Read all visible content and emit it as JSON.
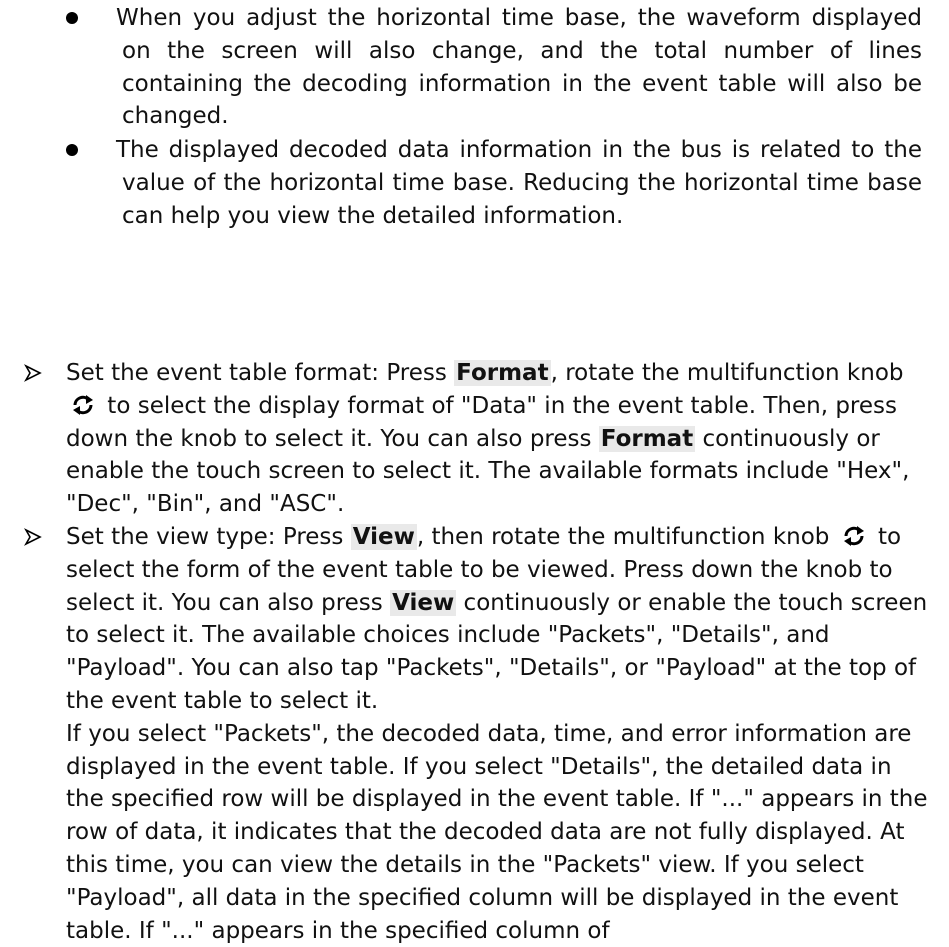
{
  "notes": [
    "When you adjust the horizontal time base, the waveform displayed on the screen will also change, and the total number of lines containing the decoding information in the event table will also be changed.",
    "The displayed decoded data information in the bus is related to the value of the horizontal time base. Reducing the horizontal time base can help you view the detailed information."
  ],
  "format_item": {
    "t1": "Set the event table format: Press ",
    "kw1": "Format",
    "t2": ", rotate the multifunction knob",
    "t3": " to select the display format of \"Data\" in the event table. Then, press down the knob to select it. You can also press ",
    "kw2": "Format",
    "t4": " continuously or enable the touch screen to select it. The available formats include \"Hex\", \"Dec\", \"Bin\", and \"ASC\"."
  },
  "view_item": {
    "t1": "Set the view type: Press ",
    "kw1": "View",
    "t2": ", then rotate the multifunction knob",
    "t3": " to select the form of the event table to be viewed. Press down the knob to select it. You can also press ",
    "kw2": "View",
    "t4": " continuously or enable the touch screen to select it. The available choices include \"Packets\", \"Details\", and \"Payload\". You can also tap \"Packets\", \"Details\", or \"Payload\" at the top of the event table to select it.",
    "para2": "If you select \"Packets\", the decoded data, time, and error information are displayed in the event table. If you select \"Details\", the detailed data in the specified row will be displayed in the event table. If \"...\" appears in the row of data, it indicates that the decoded data are not fully displayed. At this time, you can view the details in the \"Packets\" view. If you select \"Payload\", all data in the specified column will be displayed in the event table. If \"...\" appears in the specified column of"
  },
  "icons": {
    "bullet": "filled-circle-icon",
    "arrow": "arrowhead-icon",
    "knob": "rotate-knob-icon"
  }
}
